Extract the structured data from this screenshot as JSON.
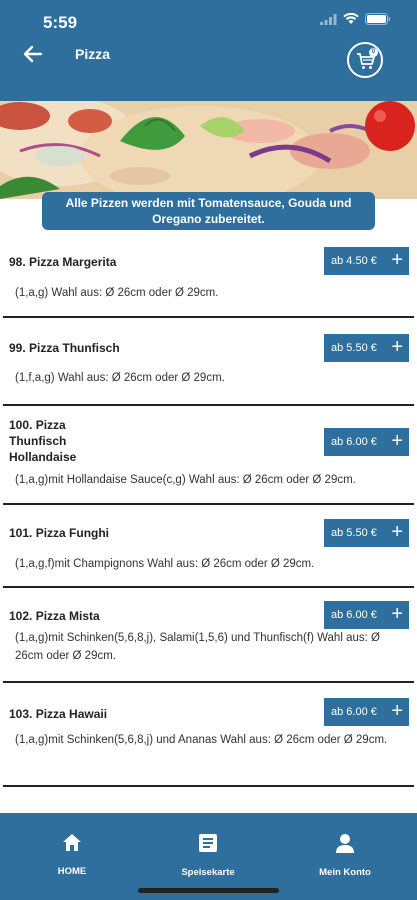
{
  "status_bar": {
    "time": "5:59"
  },
  "header": {
    "title": "Pizza",
    "cart_count": "0"
  },
  "banner": {
    "note": "Alle Pizzen werden mit Tomatensauce, Gouda und Oregano zubereitet."
  },
  "items": [
    {
      "name": "98. Pizza Margerita",
      "price": "ab 4.50 €",
      "desc": "(1,a,g) Wahl aus: Ø 26cm oder Ø 29cm."
    },
    {
      "name": "99. Pizza Thunfisch",
      "price": "ab 5.50 €",
      "desc": "(1,f,a,g) Wahl aus: Ø 26cm oder Ø 29cm."
    },
    {
      "name_lines": [
        "100. Pizza",
        "Thunfisch",
        "Hollandaise"
      ],
      "price": "ab 6.00 €",
      "desc": "(1,a,g)mit Hollandaise Sauce(c,g) Wahl aus: Ø 26cm oder Ø 29cm."
    },
    {
      "name": "101. Pizza Funghi",
      "price": "ab 5.50 €",
      "desc": "(1,a,g,f)mit Champignons Wahl aus: Ø 26cm oder Ø 29cm."
    },
    {
      "name": "102. Pizza Mista",
      "price": "ab 6.00 €",
      "desc": "(1,a,g)mit Schinken(5,6,8,j), Salami(1,5,6) und Thunfisch(f) Wahl aus: Ø 26cm oder Ø 29cm."
    },
    {
      "name": "103. Pizza Hawaii",
      "price": "ab 6.00 €",
      "desc": "(1,a,g)mit Schinken(5,6,8,j) und Ananas Wahl aus: Ø 26cm oder Ø 29cm."
    }
  ],
  "bottom_nav": [
    {
      "label": "HOME",
      "icon": "home-icon"
    },
    {
      "label": "Speisekarte",
      "icon": "menu-card-icon"
    },
    {
      "label": "Mein Konto",
      "icon": "user-icon"
    }
  ],
  "colors": {
    "primary": "#2e6f9e",
    "background": "#ffffff",
    "divider": "#222222"
  }
}
